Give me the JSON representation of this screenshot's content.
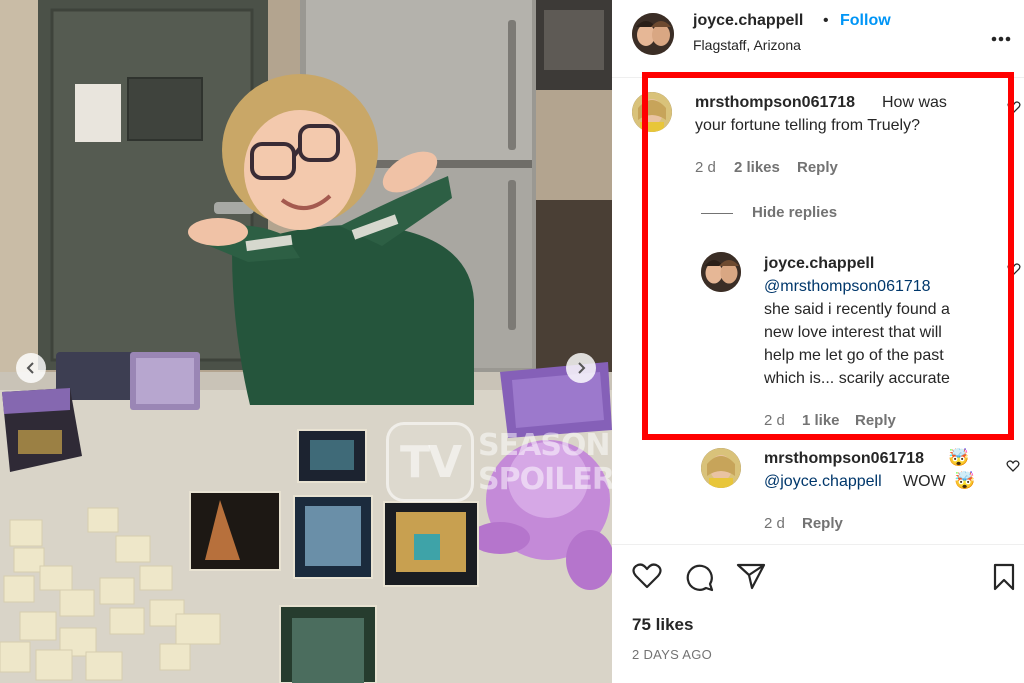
{
  "post": {
    "username": "joyce.chappell",
    "separator": "•",
    "follow_label": "Follow",
    "location": "Flagstaff, Arizona",
    "more_icon": "more-horizontal-icon"
  },
  "watermark": {
    "logo": "TV",
    "line1": "SEASON",
    "line2": "SPOILER"
  },
  "comments": [
    {
      "username": "mrsthompson061718",
      "text_line1": "How was",
      "text_line2": "your fortune telling from Truely?",
      "age": "2 d",
      "likes": "2 likes",
      "reply_label": "Reply",
      "hide_replies": "Hide replies",
      "replies": [
        {
          "username": "joyce.chappell",
          "mention": "@mrsthompson061718",
          "lines": [
            "she said i recently found a",
            "new love interest that will",
            "help me let go of the past",
            "which is... scarily accurate"
          ],
          "age": "2 d",
          "likes": "1 like",
          "reply_label": "Reply"
        }
      ]
    },
    {
      "username": "mrsthompson061718",
      "mention": "@joyce.chappell",
      "text": "WOW",
      "emoji": "🤯",
      "age": "2 d",
      "reply_label": "Reply"
    }
  ],
  "actions": {
    "icons": [
      "heart-icon",
      "comment-icon",
      "share-icon",
      "bookmark-icon"
    ],
    "likes": "75 likes",
    "timestamp": "2 DAYS AGO"
  },
  "colors": {
    "accent": "#0095f6",
    "highlight": "#ff0000",
    "link": "#00376b",
    "muted": "#737373"
  }
}
